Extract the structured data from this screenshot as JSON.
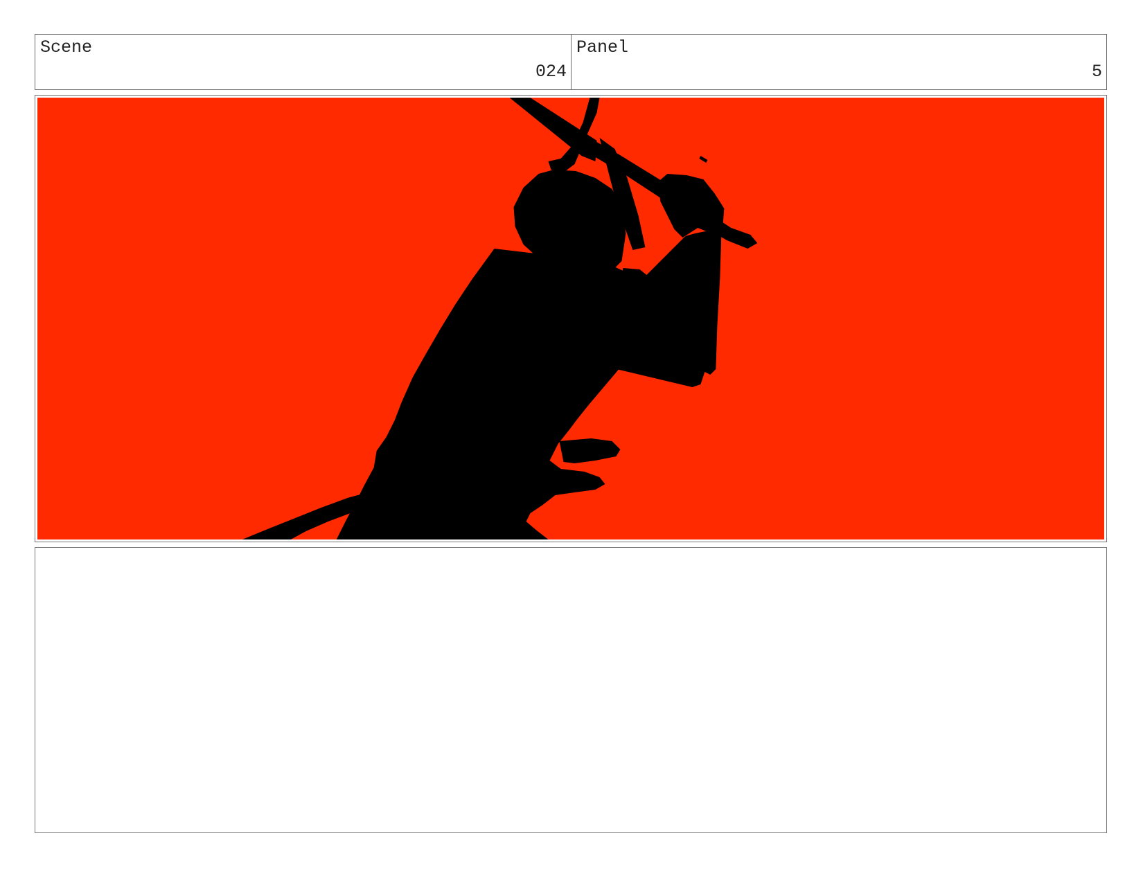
{
  "header": {
    "scene_label": "Scene",
    "scene_value": "024",
    "panel_label": "Panel",
    "panel_value": "5"
  },
  "frame": {
    "background_color": "#ff2a00",
    "silhouette_color": "#000000"
  },
  "notes": {
    "text": ""
  }
}
